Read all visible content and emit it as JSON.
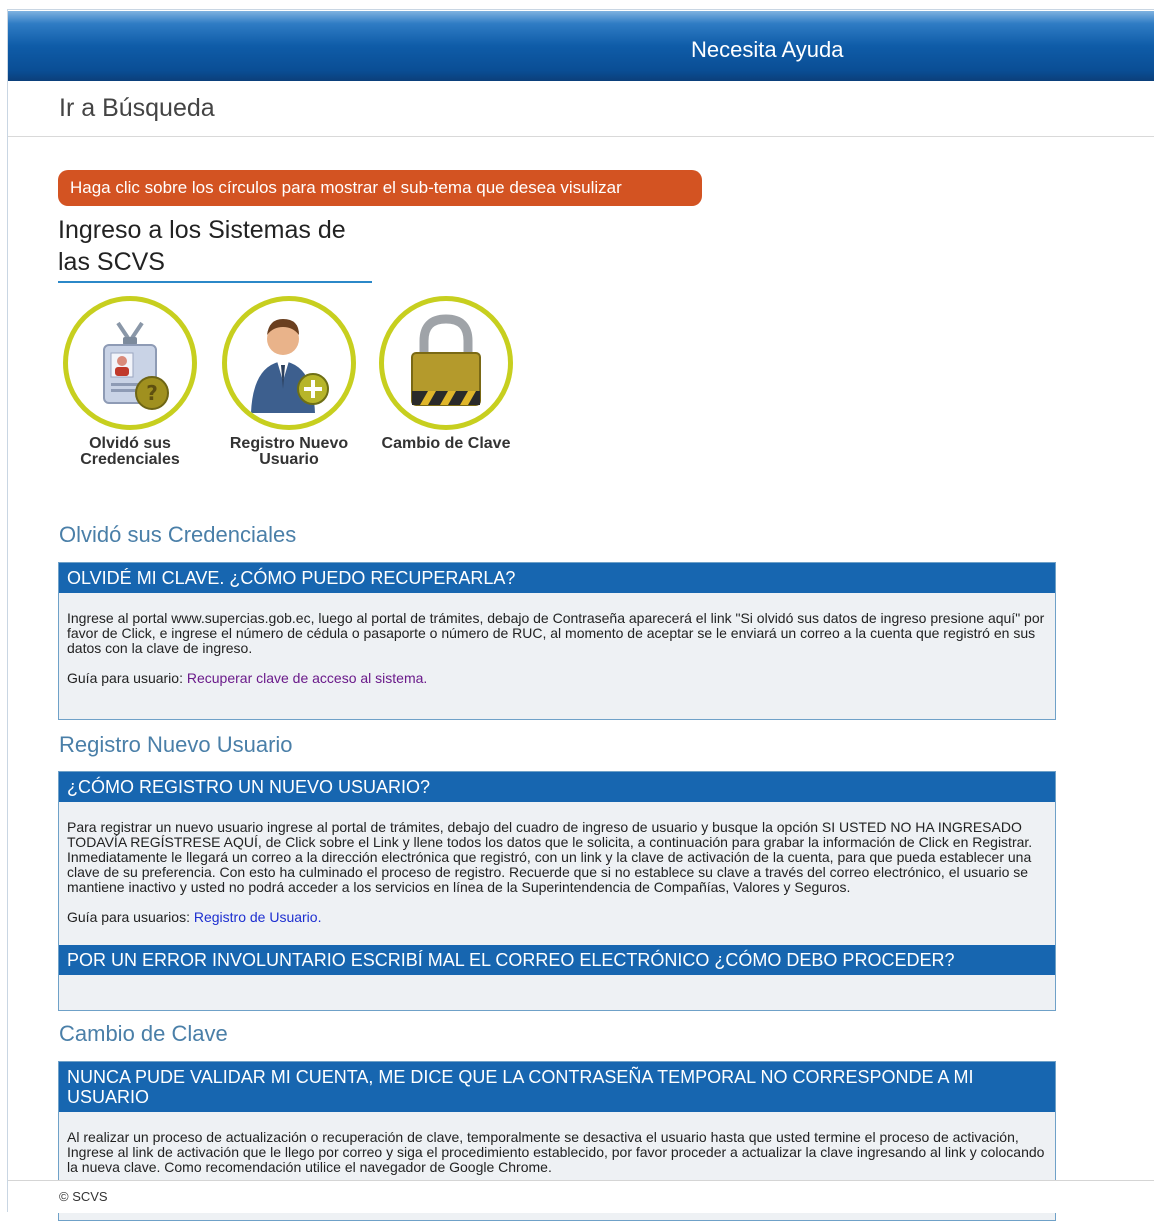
{
  "header": {
    "help_link": "Necesita Ayuda"
  },
  "breadcrumb": {
    "label": "Ir a Búsqueda"
  },
  "hint": "Haga clic sobre los círculos para mostrar el sub-tema que desea visulizar",
  "section_title": "Ingreso a los Sistemas de las SCVS",
  "topics": [
    {
      "label": "Olvidó sus Credenciales",
      "icon": "id-badge-question-icon"
    },
    {
      "label": "Registro Nuevo Usuario",
      "icon": "user-add-icon"
    },
    {
      "label": "Cambio de Clave",
      "icon": "padlock-icon"
    }
  ],
  "sections": [
    {
      "title": "Olvidó sus Credenciales",
      "items": [
        {
          "question": "OLVIDÉ MI CLAVE. ¿CÓMO PUEDO RECUPERARLA?",
          "body": "Ingrese al portal www.supercias.gob.ec, luego al portal de trámites, debajo de Contraseña aparecerá el link \"Si olvidó sus datos de ingreso presione aquí\" por favor de Click, e ingrese el número de cédula o pasaporte o número de RUC, al momento de aceptar se le enviará un correo a la cuenta que registró en sus datos con la clave de ingreso.",
          "guide_prefix": "Guía para usuario: ",
          "guide_link": "Recuperar clave de acceso al sistema."
        }
      ]
    },
    {
      "title": "Registro Nuevo Usuario",
      "items": [
        {
          "question": "¿CÓMO REGISTRO UN NUEVO USUARIO?",
          "body": "Para registrar un nuevo usuario ingrese al portal de trámites, debajo del cuadro de ingreso de usuario y busque la opción SI USTED NO HA INGRESADO TODAVÍA REGÍSTRESE AQUÍ, de Click sobre el Link y llene todos los datos que le solicita, a continuación para grabar la información de Click en Registrar. Inmediatamente le llegará un correo a la dirección electrónica que registró, con un link y la clave de activación de la cuenta, para que pueda establecer una clave de su preferencia. Con esto ha culminado el proceso de registro. Recuerde que si no establece su clave a través del correo electrónico, el usuario se mantiene inactivo y usted no podrá acceder a los servicios en línea de la Superintendencia de Compañías, Valores y Seguros.",
          "guide_prefix": "Guía para usuarios: ",
          "guide_link": "Registro de Usuario."
        },
        {
          "question": "POR UN ERROR INVOLUNTARIO ESCRIBÍ MAL EL CORREO ELECTRÓNICO ¿CÓMO DEBO PROCEDER?"
        }
      ]
    },
    {
      "title": "Cambio de Clave",
      "items": [
        {
          "question": "NUNCA PUDE VALIDAR MI CUENTA, ME DICE QUE LA CONTRASEÑA TEMPORAL NO CORRESPONDE A MI USUARIO",
          "body": "Al realizar un proceso de actualización o recuperación de clave, temporalmente se desactiva el usuario hasta que usted termine el proceso de activación, Ingrese al link de activación que le llego por correo y siga el procedimiento establecido, por favor proceder a actualizar la clave ingresando al link y colocando la nueva clave. Como recomendación utilice el navegador de Google Chrome."
        }
      ]
    }
  ],
  "footer": {
    "copyright": "© SCVS"
  }
}
